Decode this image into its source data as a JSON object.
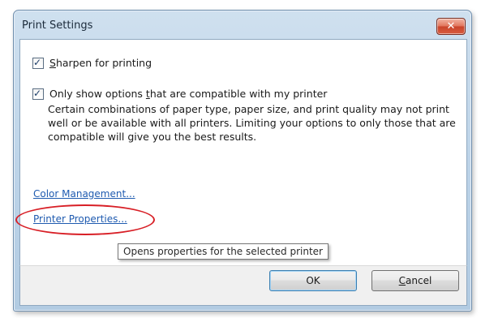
{
  "window": {
    "title": "Print Settings",
    "close_glyph": "✕"
  },
  "options": {
    "sharpen": {
      "prefix": "",
      "accel": "S",
      "rest": "harpen for printing",
      "checked": true
    },
    "compatible": {
      "before": "Only show options ",
      "accel": "t",
      "after": "hat are compatible with my printer",
      "checked": true,
      "description": "Certain combinations of paper type, paper size, and print quality may not print well or be available with all printers. Limiting your options to only those that are compatible will give you the best results."
    }
  },
  "links": {
    "color_management": "Color Management...",
    "printer_properties": "Printer Properties..."
  },
  "tooltip": "Opens properties for the selected printer",
  "buttons": {
    "ok": "OK",
    "cancel_accel": "C",
    "cancel_rest": "ancel"
  },
  "colors": {
    "highlight_circle": "#d81f26",
    "link": "#1f5bb0"
  },
  "icons": {
    "checkbox_tick": "✓"
  }
}
